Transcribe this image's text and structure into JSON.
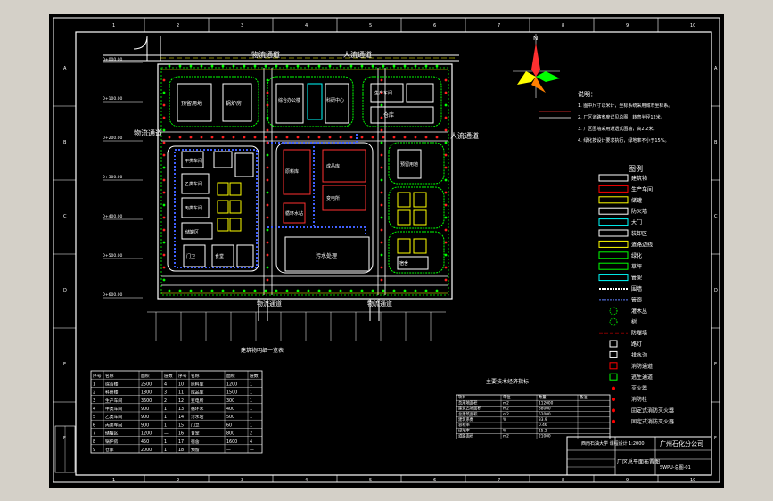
{
  "sheet": {
    "grid_cols": [
      "1",
      "2",
      "3",
      "4",
      "5",
      "6",
      "7",
      "8",
      "9",
      "10"
    ],
    "grid_rows": [
      "A",
      "B",
      "C",
      "D",
      "E",
      "F"
    ]
  },
  "site_plan": {
    "roads": {
      "north_left": "物流通道",
      "north_right": "人流通道",
      "west": "物流通道",
      "east": "人流通道",
      "south_left": "物流通道",
      "south_right": "物流通道"
    },
    "elevations": [
      "0+000.00",
      "0+100.00",
      "0+200.00",
      "0+300.00",
      "0+400.00",
      "0+500.00",
      "0+600.00"
    ],
    "buildings": {
      "b1": "预留用地",
      "b2": "锅炉房",
      "b3": "综合办公楼",
      "b4": "科研中心",
      "b5": "生产车间",
      "b6": "仓库",
      "b7": "甲类车间",
      "b8": "乙类车间",
      "b9": "丙类车间",
      "b10": "储罐区",
      "b11": "原料库",
      "b12": "成品库",
      "b13": "变电所",
      "b14": "循环水站",
      "b15": "污水处理",
      "b16": "预留用地",
      "b17": "门卫",
      "b18": "食堂",
      "b19": "宿舍"
    }
  },
  "notes": {
    "heading": "说明：",
    "lines": [
      "1. 图中尺寸以米计，坐标系统采用城市坐标系。",
      "2. 厂区道路宽度详见总图，转弯半径12米。",
      "3. 厂区围墙采用通透式围墙，高2.2米。",
      "4. 绿化按设计要求执行，绿地率不小于15%。"
    ]
  },
  "north_arrow": {
    "label": "N"
  },
  "legend": {
    "title": "图例",
    "items": [
      {
        "label": "建筑物",
        "color": "#ffffff",
        "kind": "box"
      },
      {
        "label": "生产车间",
        "color": "#ff0000",
        "kind": "box"
      },
      {
        "label": "储罐",
        "color": "#ffff00",
        "kind": "box"
      },
      {
        "label": "防火墙",
        "color": "#ffffff",
        "kind": "box"
      },
      {
        "label": "大门",
        "color": "#00ffff",
        "kind": "box"
      },
      {
        "label": "装卸区",
        "color": "#ffffff",
        "kind": "box"
      },
      {
        "label": "道路边线",
        "color": "#ffff00",
        "kind": "box"
      },
      {
        "label": "绿化",
        "color": "#00ff00",
        "kind": "box"
      },
      {
        "label": "草坪",
        "color": "#00ff00",
        "kind": "box"
      },
      {
        "label": "管架",
        "color": "#00ffff",
        "kind": "box"
      },
      {
        "label": "围墙",
        "color": "#ffffff",
        "kind": "line"
      },
      {
        "label": "管廊",
        "color": "#6080ff",
        "kind": "line"
      },
      {
        "label": "灌木丛",
        "color": "#00ff00",
        "kind": "shrub"
      },
      {
        "label": "树",
        "color": "#00ff00",
        "kind": "shrub"
      },
      {
        "label": "防爆墙",
        "color": "#ff0000",
        "kind": "dash"
      },
      {
        "label": "路灯",
        "color": "#ffffff",
        "kind": "glyph"
      },
      {
        "label": "排水沟",
        "color": "#ffffff",
        "kind": "glyph"
      },
      {
        "label": "消防通道",
        "color": "#ff0000",
        "kind": "glyph"
      },
      {
        "label": "逃生通道",
        "color": "#00ff00",
        "kind": "glyph"
      },
      {
        "label": "灭火器",
        "color": "#ff0000",
        "kind": "dot"
      },
      {
        "label": "消防栓",
        "color": "#ff0000",
        "kind": "dot"
      },
      {
        "label": "固定式消防灭火器",
        "color": "#ff0000",
        "kind": "dot"
      },
      {
        "label": "固定式消防灭火器",
        "color": "#ff0000",
        "kind": "dot"
      }
    ]
  },
  "table_main": {
    "caption": "建筑物明细一览表",
    "headers": [
      "序号",
      "名称",
      "面积",
      "层数",
      "序号",
      "名称",
      "面积",
      "层数"
    ],
    "rows": [
      [
        "1",
        "综合楼",
        "2500",
        "4",
        "10",
        "原料库",
        "1200",
        "1"
      ],
      [
        "2",
        "科研楼",
        "1800",
        "3",
        "11",
        "成品库",
        "1500",
        "1"
      ],
      [
        "3",
        "生产车间",
        "3600",
        "2",
        "12",
        "变电所",
        "300",
        "1"
      ],
      [
        "4",
        "甲类车间",
        "900",
        "1",
        "13",
        "循环水",
        "400",
        "1"
      ],
      [
        "5",
        "乙类车间",
        "900",
        "1",
        "14",
        "污水站",
        "500",
        "1"
      ],
      [
        "6",
        "丙类车间",
        "900",
        "1",
        "15",
        "门卫",
        "60",
        "1"
      ],
      [
        "7",
        "储罐区",
        "1200",
        "—",
        "16",
        "食堂",
        "800",
        "2"
      ],
      [
        "8",
        "锅炉房",
        "450",
        "1",
        "17",
        "宿舍",
        "1600",
        "4"
      ],
      [
        "9",
        "仓库",
        "2000",
        "1",
        "18",
        "预留",
        "—",
        "—"
      ]
    ]
  },
  "table_econ": {
    "caption": "主要技术经济指标",
    "headers": [
      "项目",
      "单位",
      "数量",
      "备注"
    ],
    "rows": [
      [
        "总用地面积",
        "m2",
        "112000",
        ""
      ],
      [
        "建筑占地面积",
        "m2",
        "38000",
        ""
      ],
      [
        "总建筑面积",
        "m2",
        "52000",
        ""
      ],
      [
        "建筑系数",
        "%",
        "33.9",
        ""
      ],
      [
        "容积率",
        "",
        "0.46",
        ""
      ],
      [
        "绿地率",
        "%",
        "15.2",
        ""
      ],
      [
        "道路面积",
        "m2",
        "21000",
        ""
      ]
    ]
  },
  "title_block": {
    "school": "西南石油大学 课程设计",
    "scale": "1:2000",
    "project": "广州石化分公司",
    "drawing": "厂区总平面布置图",
    "number": "SWPU-总图-01"
  }
}
